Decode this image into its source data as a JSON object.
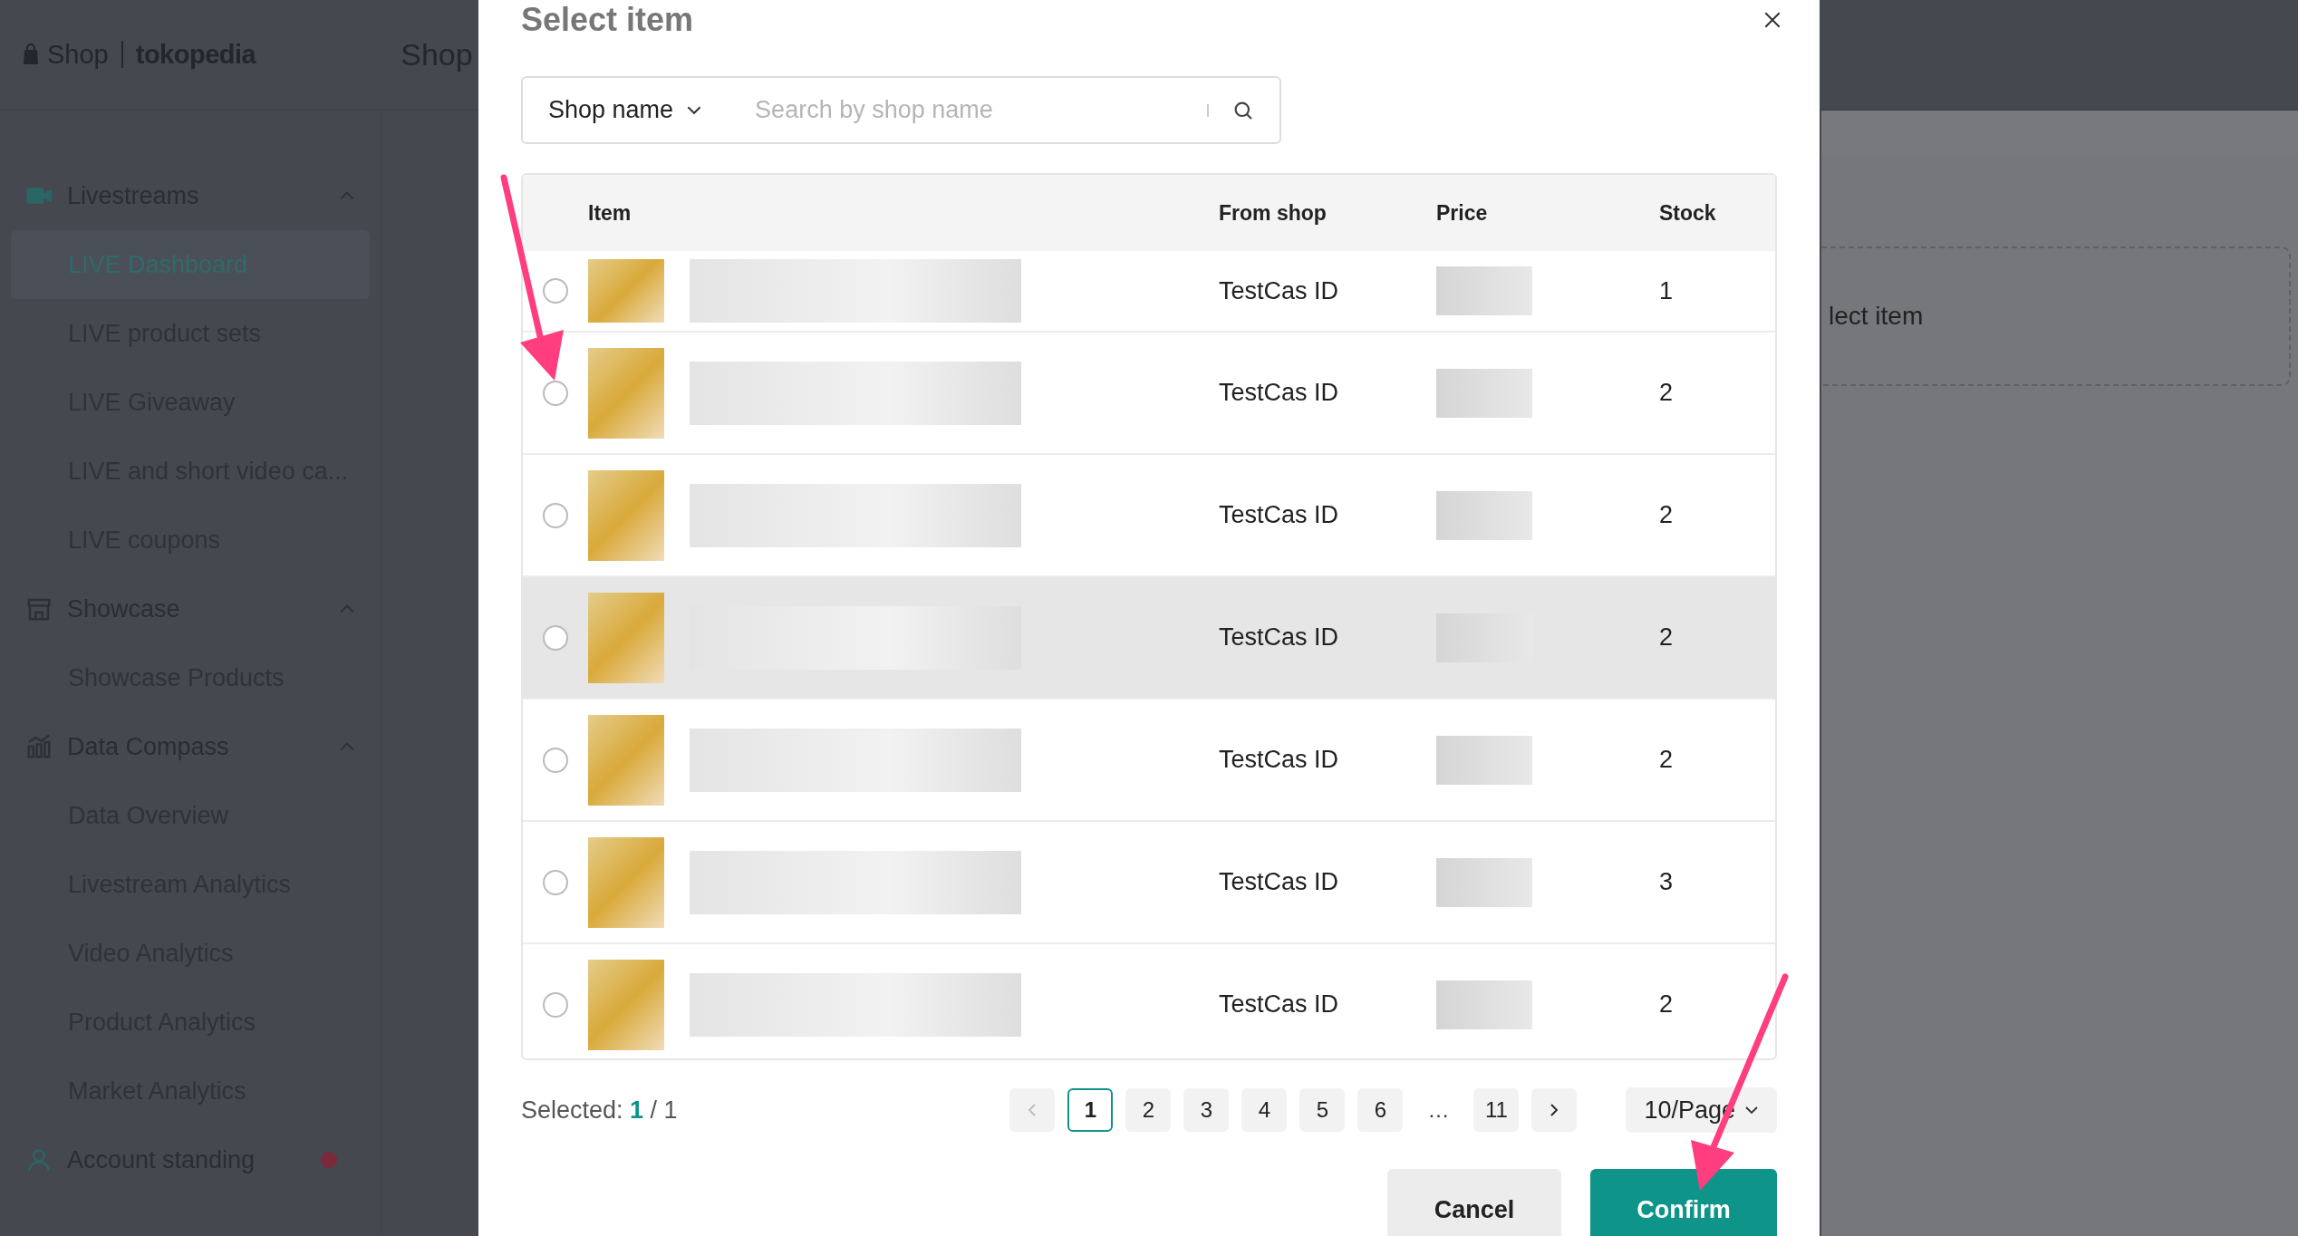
{
  "header": {
    "logo_shop": "Shop",
    "logo_brand": "tokopedia",
    "title": "Shop"
  },
  "sidebar": {
    "groups": [
      {
        "label": "Livestreams",
        "expanded": true,
        "children": [
          {
            "label": "LIVE Dashboard",
            "selected": true
          },
          {
            "label": "LIVE product sets",
            "selected": false
          },
          {
            "label": "LIVE Giveaway",
            "selected": false
          },
          {
            "label": "LIVE and short video ca...",
            "selected": false
          },
          {
            "label": "LIVE coupons",
            "selected": false
          }
        ]
      },
      {
        "label": "Showcase",
        "expanded": true,
        "children": [
          {
            "label": "Showcase Products",
            "selected": false
          }
        ]
      },
      {
        "label": "Data Compass",
        "expanded": true,
        "children": [
          {
            "label": "Data Overview",
            "selected": false
          },
          {
            "label": "Livestream Analytics",
            "selected": false
          },
          {
            "label": "Video Analytics",
            "selected": false
          },
          {
            "label": "Product Analytics",
            "selected": false
          },
          {
            "label": "Market Analytics",
            "selected": false
          }
        ]
      }
    ],
    "account": {
      "label": "Account standing"
    }
  },
  "background": {
    "dropzone_text": "lect item"
  },
  "modal": {
    "title": "Select item",
    "search": {
      "filter": "Shop name",
      "placeholder": "Search by shop name"
    },
    "table": {
      "columns": [
        "Item",
        "From shop",
        "Price",
        "Stock"
      ],
      "rows": [
        {
          "shop": "TestCas ID",
          "stock": "1",
          "selected": false,
          "highlighted": false
        },
        {
          "shop": "TestCas ID",
          "stock": "2",
          "selected": false,
          "highlighted": false
        },
        {
          "shop": "TestCas ID",
          "stock": "2",
          "selected": false,
          "highlighted": false
        },
        {
          "shop": "TestCas ID",
          "stock": "2",
          "selected": false,
          "highlighted": true
        },
        {
          "shop": "TestCas ID",
          "stock": "2",
          "selected": false,
          "highlighted": false
        },
        {
          "shop": "TestCas ID",
          "stock": "3",
          "selected": false,
          "highlighted": false
        },
        {
          "shop": "TestCas ID",
          "stock": "2",
          "selected": false,
          "highlighted": false
        }
      ]
    },
    "footer": {
      "selected_label": "Selected:",
      "selected_count": "1",
      "selected_total": "/ 1"
    },
    "pagination": {
      "prev_disabled": true,
      "next_disabled": false,
      "pages": [
        {
          "label": "1",
          "kind": "page",
          "selected": true
        },
        {
          "label": "2",
          "kind": "page",
          "selected": false
        },
        {
          "label": "3",
          "kind": "page",
          "selected": false
        },
        {
          "label": "4",
          "kind": "page",
          "selected": false
        },
        {
          "label": "5",
          "kind": "page",
          "selected": false
        },
        {
          "label": "6",
          "kind": "page",
          "selected": false
        },
        {
          "label": "…",
          "kind": "ellipsis"
        },
        {
          "label": "11",
          "kind": "page",
          "selected": false
        }
      ],
      "page_size": "10/Page"
    },
    "buttons": {
      "cancel": "Cancel",
      "confirm": "Confirm"
    }
  }
}
